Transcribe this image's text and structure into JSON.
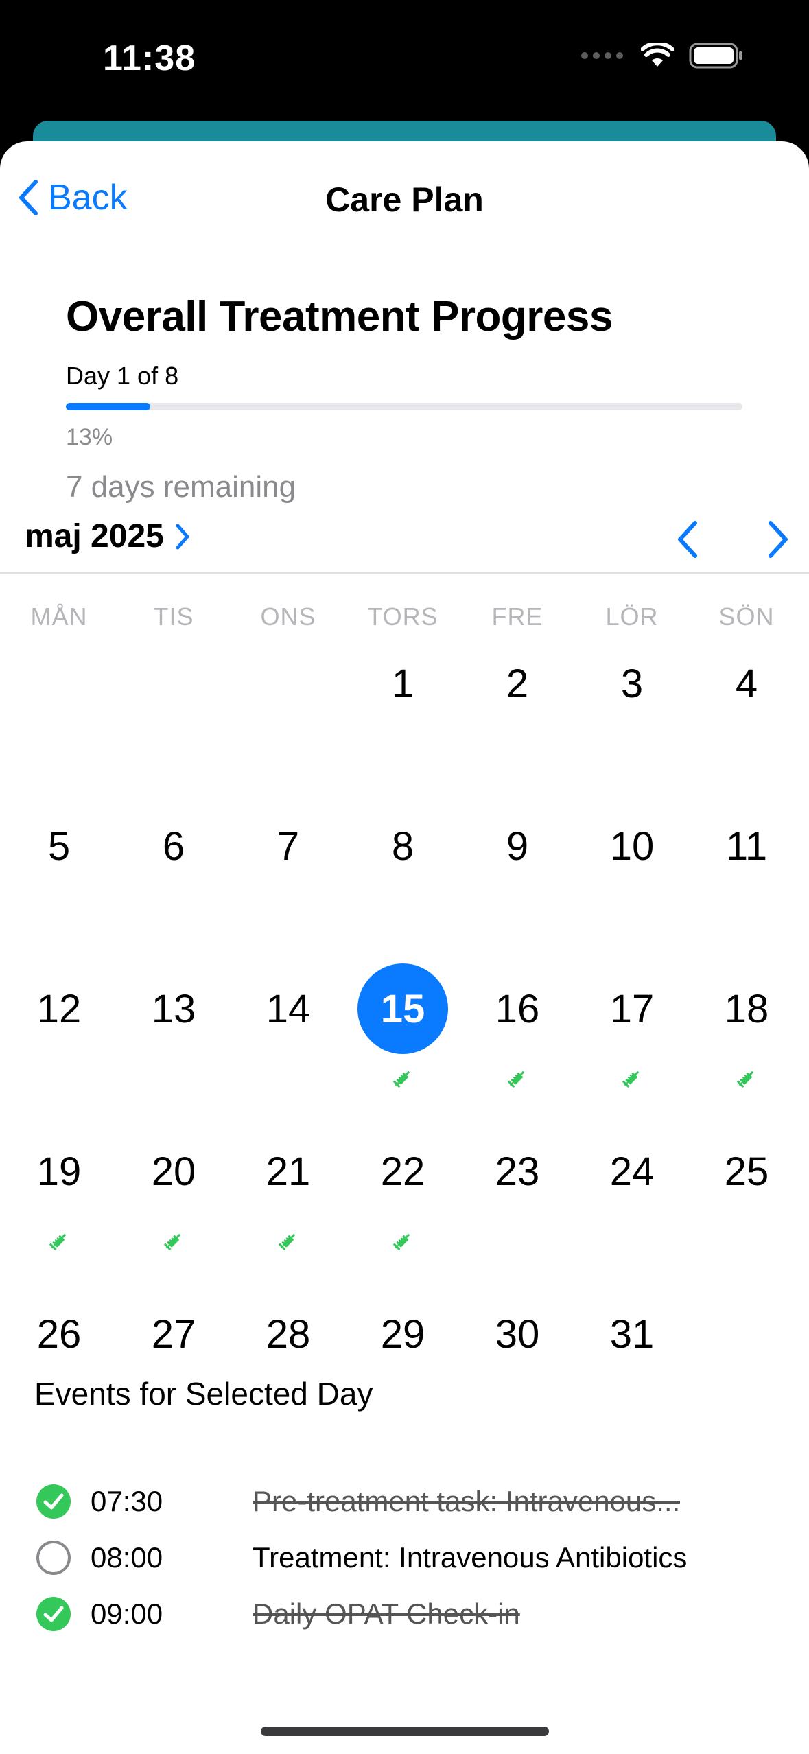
{
  "status_bar": {
    "time": "11:38",
    "icons": [
      "signal-dots-icon",
      "wifi-icon",
      "battery-icon"
    ]
  },
  "nav": {
    "back_label": "Back",
    "title": "Care Plan"
  },
  "progress": {
    "title": "Overall Treatment Progress",
    "day_label": "Day 1 of 8",
    "percent_label": "13%",
    "percent_value": 0.125,
    "remaining_label": "7 days remaining"
  },
  "calendar": {
    "month_label": "maj 2025",
    "weekdays": [
      "MÅN",
      "TIS",
      "ONS",
      "TORS",
      "FRE",
      "LÖR",
      "SÖN"
    ],
    "first_weekday_index": 3,
    "days_in_month": 31,
    "selected_day": 15,
    "treatment_days": [
      15,
      16,
      17,
      18,
      19,
      20,
      21,
      22
    ],
    "accent_color": "#0a7aff",
    "marker_color": "#34c759"
  },
  "events": {
    "title": "Events for Selected Day",
    "items": [
      {
        "time": "07:30",
        "text": "Pre-treatment task: Intravenous...",
        "done": true
      },
      {
        "time": "08:00",
        "text": "Treatment: Intravenous Antibiotics",
        "done": false
      },
      {
        "time": "09:00",
        "text": "Daily OPAT Check-in",
        "done": true
      }
    ]
  }
}
